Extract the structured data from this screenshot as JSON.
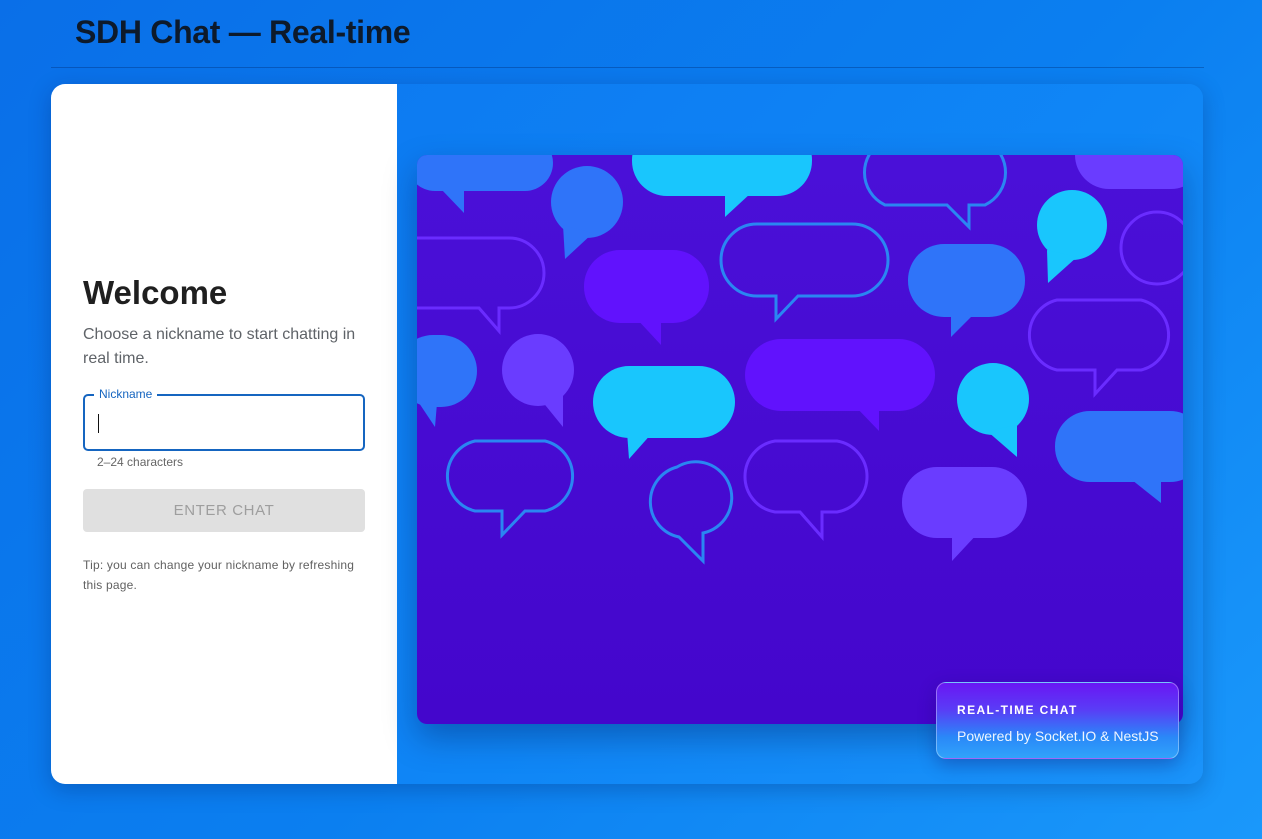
{
  "header": {
    "title": "SDH Chat — Real-time"
  },
  "login": {
    "heading": "Welcome",
    "subtitle": "Choose a nickname to start chatting in real time.",
    "nickname_label": "Nickname",
    "nickname_value": "",
    "helper": "2–24 characters",
    "enter_button": "ENTER CHAT",
    "tip": "Tip: you can change your nickname by refreshing this page."
  },
  "hero": {
    "illustration": "chat-bubbles-illustration",
    "badge_title": "REAL-TIME CHAT",
    "badge_subtitle": "Powered by Socket.IO & NestJS"
  },
  "colors": {
    "accent": "#1565c0",
    "background": "#0b7ff0",
    "illustration_bg": "#4a0fd6",
    "bubble_cyan": "#19c6fd",
    "bubble_blue": "#2f74f9",
    "bubble_violet": "#6112fd"
  }
}
